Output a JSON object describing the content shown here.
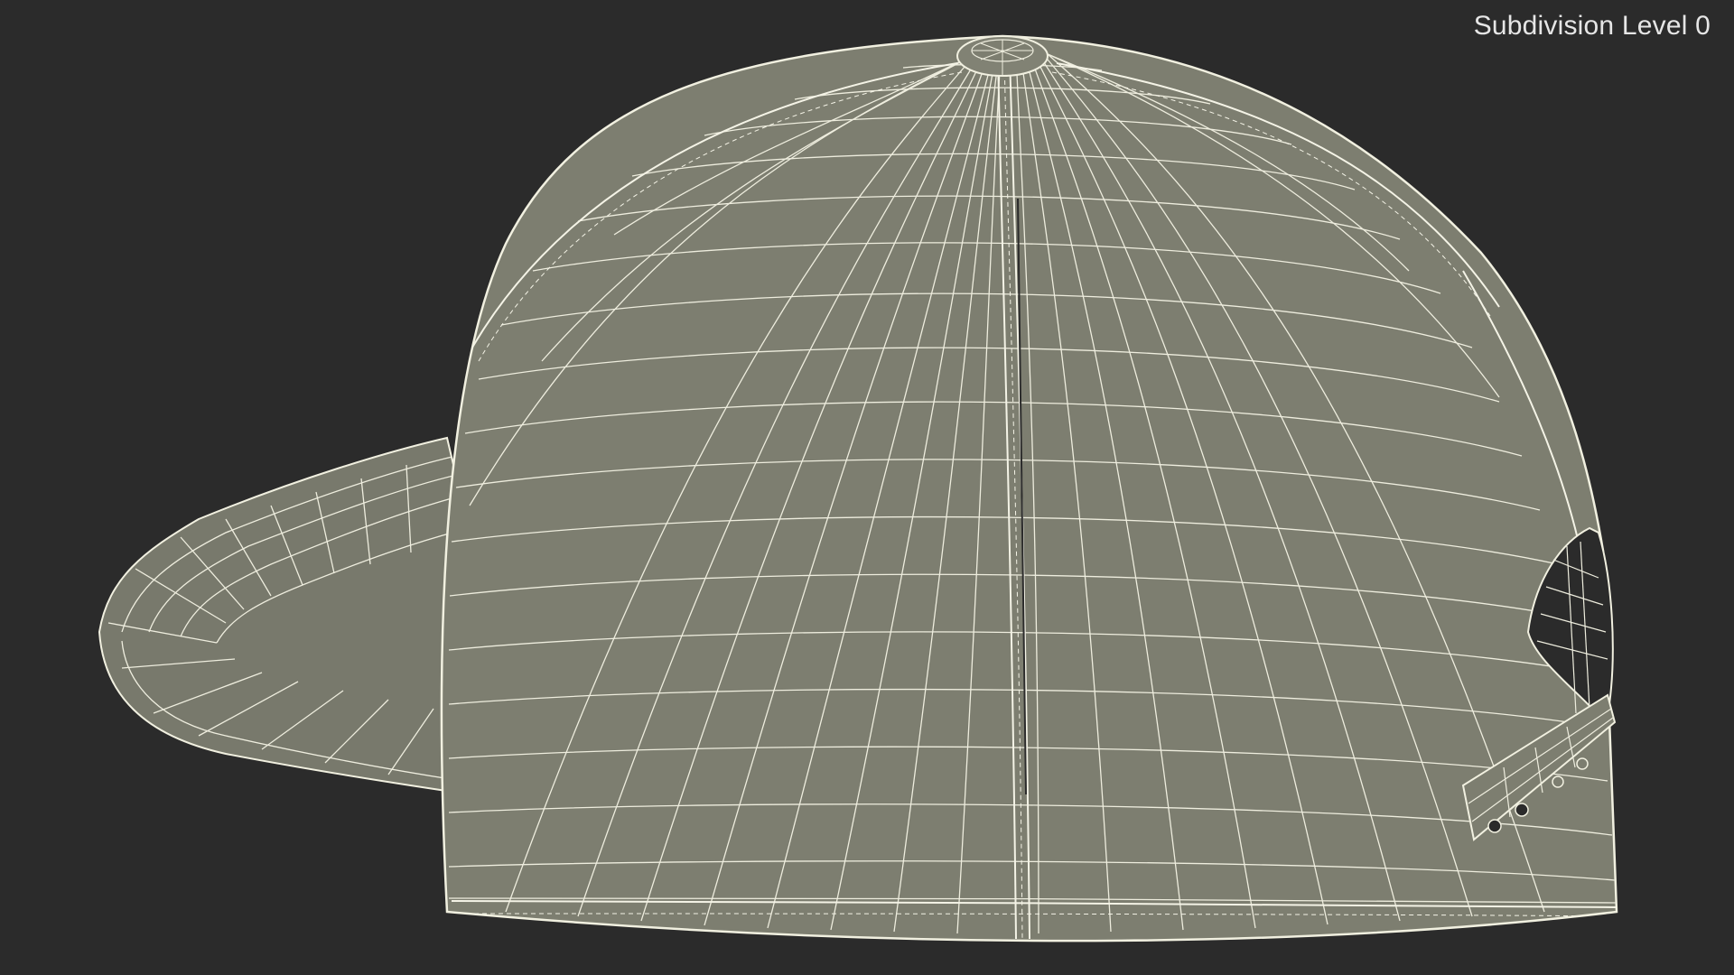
{
  "overlay": {
    "subdivision_label": "Subdivision Level 0"
  },
  "model": {
    "subject": "snapback cap wireframe",
    "surface_color": "#7d7e70",
    "wire_color": "#f1f0e0",
    "background_color": "#2b2b2b"
  }
}
